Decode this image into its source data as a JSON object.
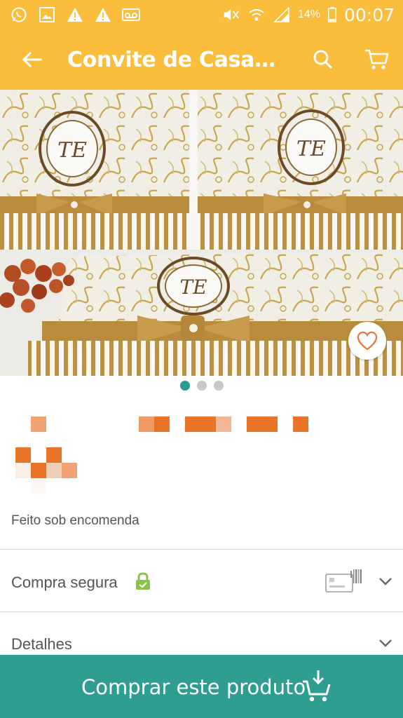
{
  "status_bar": {
    "battery_percent": "14%",
    "time": "00:07",
    "left_icons": [
      "whatsapp-icon",
      "image-icon",
      "warning-icon",
      "warning-icon",
      "voicemail-icon"
    ],
    "right_icons": [
      "mute-icon",
      "wifi-icon",
      "signal-icon",
      "battery-icon"
    ]
  },
  "app_bar": {
    "title": "Convite de Casamen…",
    "icons": [
      "back-arrow-icon",
      "search-icon",
      "cart-icon"
    ]
  },
  "gallery": {
    "total_images": 3,
    "active_index": 0,
    "monogram": "TE"
  },
  "details": {
    "made_to_order": "Feito sob encomenda"
  },
  "sections": {
    "secure_purchase": "Compra segura",
    "details": "Detalhes"
  },
  "buy_button": {
    "label": "Comprar este produto"
  },
  "colors": {
    "brand_yellow": "#fbbd3c",
    "brand_teal": "#2f9d8f",
    "lock_green": "#8bc34a",
    "pixel_orange": "#e97326"
  }
}
